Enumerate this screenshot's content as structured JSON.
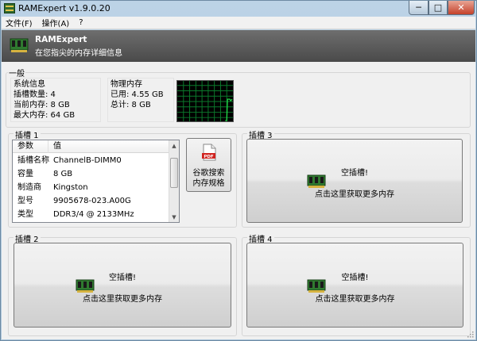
{
  "window": {
    "title": "RAMExpert v1.9.0.20",
    "minimize_glyph": "─",
    "maximize_glyph": "□",
    "close_glyph": "✕"
  },
  "menu": {
    "items": [
      {
        "label": "文件(F)"
      },
      {
        "label": "操作(A)"
      },
      {
        "label": "?"
      }
    ]
  },
  "banner": {
    "title": "RAMExpert",
    "subtitle": "在您指尖的内存详细信息",
    "icon": "ram-module-icon"
  },
  "general": {
    "title": "一般",
    "system": {
      "title": "系统信息",
      "lines": [
        "插槽数量: 4",
        "当前内存: 8 GB",
        "最大内存: 64 GB"
      ]
    },
    "physical": {
      "title": "物理内存",
      "lines": [
        "已用: 4.55 GB",
        "总计: 8 GB"
      ]
    },
    "graph": {
      "icon": "memory-usage-graph"
    }
  },
  "slot1": {
    "title": "插槽 1",
    "headers": [
      "参数",
      "值"
    ],
    "rows": [
      {
        "k": "插槽名称",
        "v": "ChannelB-DIMM0"
      },
      {
        "k": "容量",
        "v": "8 GB"
      },
      {
        "k": "制造商",
        "v": "Kingston"
      },
      {
        "k": "型号",
        "v": "9905678-023.A00G"
      },
      {
        "k": "类型",
        "v": "DDR3/4 @ 2133MHz"
      }
    ],
    "pdf_button": {
      "line1": "谷歌搜索",
      "line2": "内存规格",
      "icon_text": "PDF"
    }
  },
  "slots": [
    {
      "title": "插槽 2",
      "empty": "空插槽!",
      "more": "点击这里获取更多内存"
    },
    {
      "title": "插槽 3",
      "empty": "空插槽!",
      "more": "点击这里获取更多内存"
    },
    {
      "title": "插槽 4",
      "empty": "空插槽!",
      "more": "点击这里获取更多内存"
    }
  ],
  "colors": {
    "graph_grid": "#0b7a2c",
    "graph_line": "#25e34a",
    "banner_bg": "#5a5a5a",
    "ram_pcb": "#2f7a2f",
    "ram_chip": "#1a1a1a",
    "ram_pins": "#d6b340",
    "pdf_red": "#d0231f"
  }
}
